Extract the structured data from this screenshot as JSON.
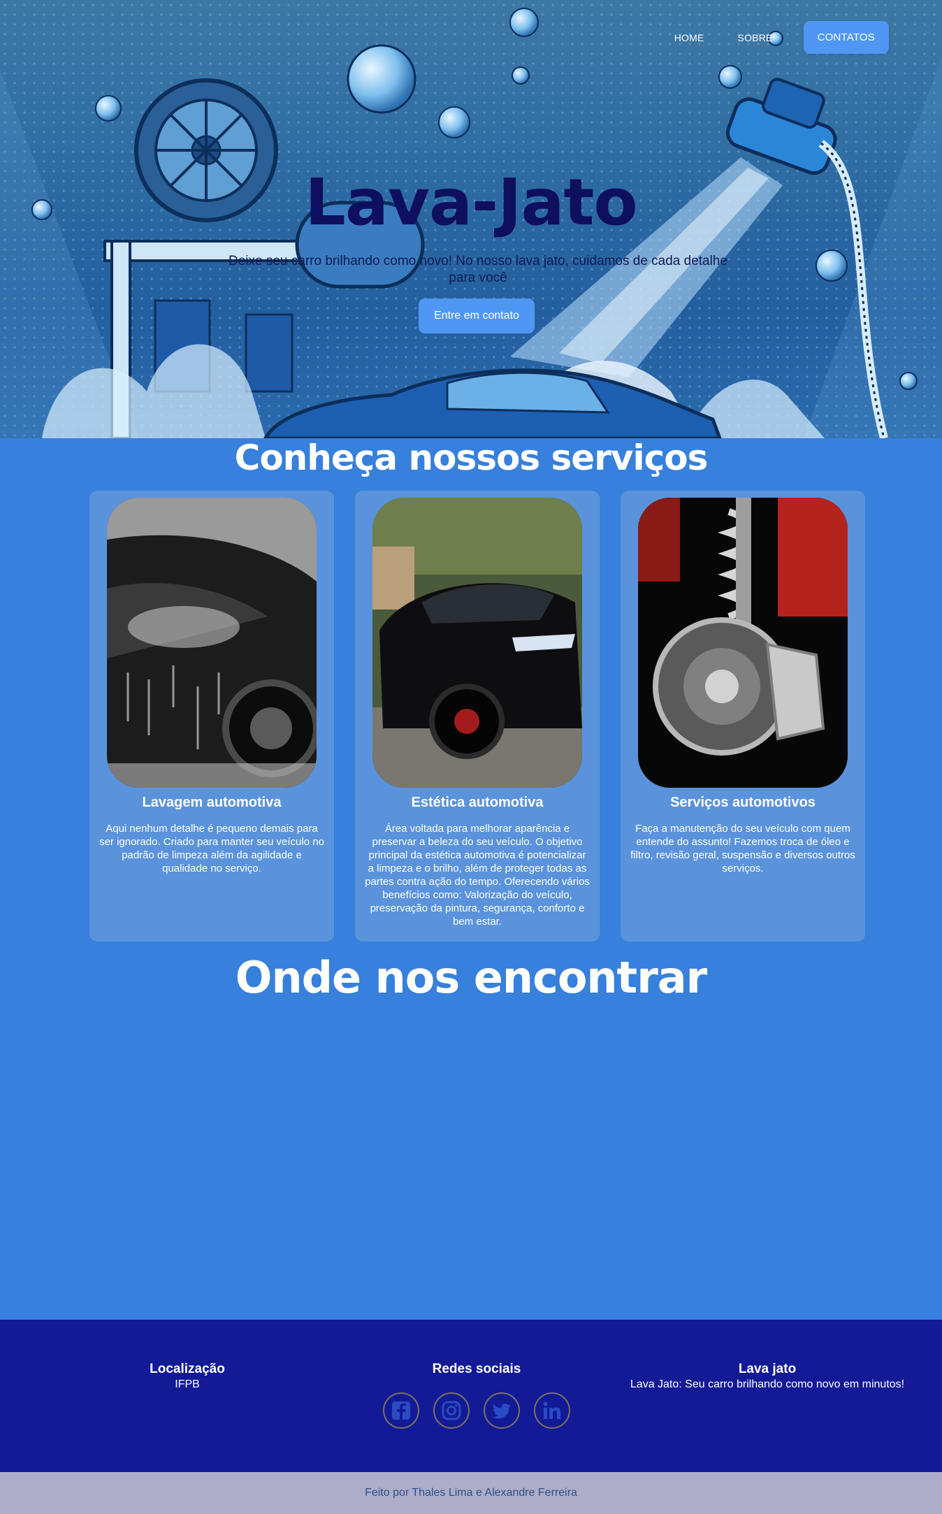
{
  "nav": {
    "home": "HOME",
    "sobre": "SOBRE",
    "contatos": "CONTATOS"
  },
  "hero": {
    "title": "Lava-Jato",
    "subtitle": "Deixe seu carro brilhando como novo! No nosso lava jato, cuidamos de cada detalhe para você",
    "cta": "Entre em contato"
  },
  "services": {
    "title": "Conheça nossos serviços",
    "cards": [
      {
        "title": "Lavagem automotiva",
        "description": "Aqui nenhum detalhe é pequeno demais para ser ignorado. Criado para manter seu veículo no padrão de limpeza além da agilidade e qualidade no serviço."
      },
      {
        "title": "Estética automotiva",
        "description": "Área voltada para melhorar aparência e preservar a beleza do seu veículo. O objetivo principal da estética automotiva é potencializar a limpeza e o brilho, além de proteger todas as partes contra ação do tempo. Oferecendo vários benefícios como: Valorização do veículo, preservação da pintura, segurança, conforto e bem estar."
      },
      {
        "title": "Serviços automotivos",
        "description": "Faça a manutenção do seu veículo com quem entende do assunto! Fazemos troca de óleo e filtro, revisão geral, suspensão e diversos outros serviços."
      }
    ]
  },
  "location": {
    "title": "Onde nos encontrar"
  },
  "footer": {
    "location_title": "Localização",
    "location_value": "IFPB",
    "social_title": "Redes sociais",
    "socials": [
      "facebook-icon",
      "instagram-icon",
      "twitter-icon",
      "linkedin-icon"
    ],
    "brand_title": "Lava jato",
    "brand_tagline": "Lava Jato: Seu carro brilhando como novo em minutos!",
    "credits": "Feito por Thales Lima e Alexandre Ferreira"
  },
  "colors": {
    "page_bg": "#3780dc",
    "card_bg": "#5a93db",
    "button": "#4f97f3",
    "hero_title": "#0e0f5e",
    "footer_bg": "#131a96",
    "credits_bg": "#adadc9",
    "social_icon": "#2a4bc4"
  }
}
